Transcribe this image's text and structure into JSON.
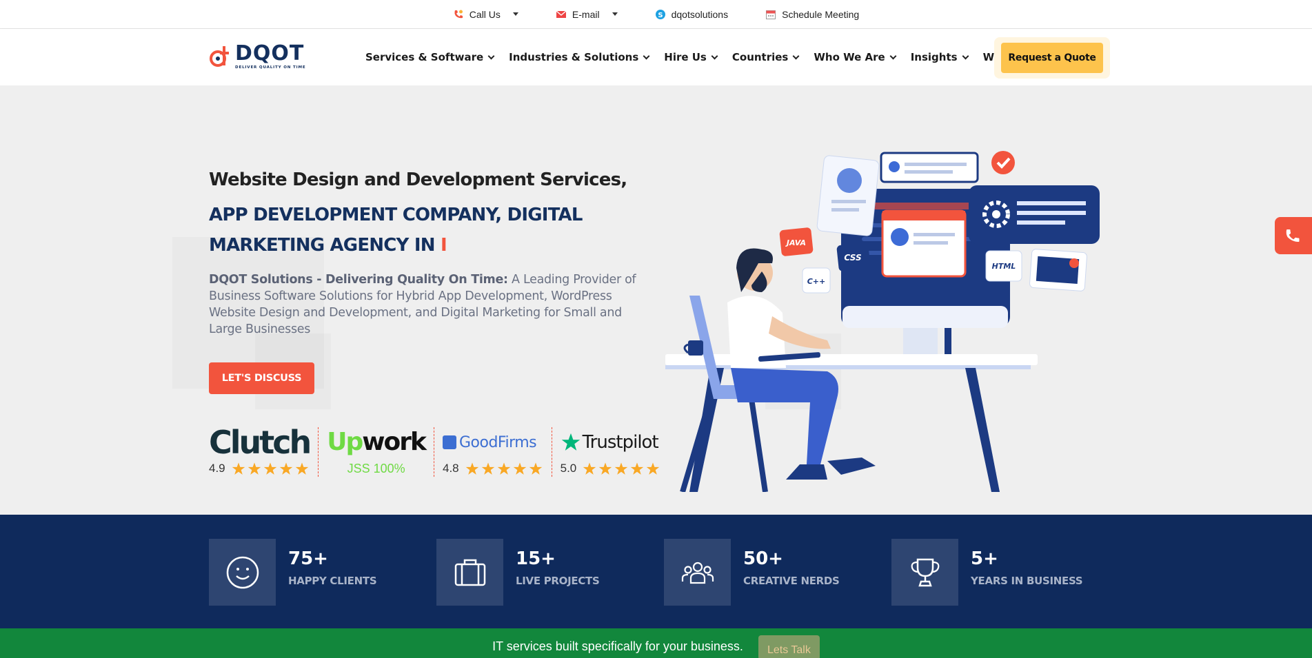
{
  "topbar": {
    "call_label": "Call Us",
    "email_label": "E-mail",
    "skype_label": "dqotsolutions",
    "schedule_label": "Schedule Meeting"
  },
  "brand": {
    "name": "DQOT",
    "tagline": "DELIVER QUALITY ON TIME"
  },
  "nav": {
    "items": [
      {
        "label": "Services & Software",
        "has_dropdown": true
      },
      {
        "label": "Industries & Solutions",
        "has_dropdown": true
      },
      {
        "label": "Hire Us",
        "has_dropdown": true
      },
      {
        "label": "Countries",
        "has_dropdown": true
      },
      {
        "label": "Who We Are",
        "has_dropdown": true
      },
      {
        "label": "Insights",
        "has_dropdown": true
      },
      {
        "label": "Work",
        "has_dropdown": false
      }
    ],
    "quote_label": "Request a Quote"
  },
  "hero": {
    "headline_line1": "Website Design and Development Services,",
    "headline_line2": "APP DEVELOPMENT COMPANY, DIGITAL MARKETING AGENCY IN",
    "typing_cursor": "I",
    "lead_bold": "DQOT Solutions - Delivering Quality On Time:",
    "lead_text": " A Leading Provider of Business Software Solutions for Hybrid App Development, WordPress Website Design and Development, and Digital Marketing for Small and Large Businesses",
    "cta_label": "LET'S DISCUSS"
  },
  "reviews": [
    {
      "platform": "Clutch",
      "rating": "4.9",
      "stars": 5
    },
    {
      "platform": "Upwork",
      "score_text": "JSS 100%"
    },
    {
      "platform": "GoodFirms",
      "rating": "4.8",
      "stars": 5
    },
    {
      "platform": "Trustpilot",
      "rating": "5.0",
      "stars": 5
    }
  ],
  "illustration": {
    "tags": [
      "JAVA",
      "CSS",
      "C++",
      "HTML"
    ]
  },
  "stats": [
    {
      "number": "75+",
      "label": "HAPPY CLIENTS",
      "icon": "smile-icon"
    },
    {
      "number": "15+",
      "label": "LIVE PROJECTS",
      "icon": "briefcase-icon"
    },
    {
      "number": "50+",
      "label": "CREATIVE NERDS",
      "icon": "team-icon"
    },
    {
      "number": "5+",
      "label": "YEARS IN BUSINESS",
      "icon": "trophy-icon"
    }
  ],
  "banner": {
    "text": "IT services built specifically for your business.",
    "button_label": "Lets Talk"
  },
  "colors": {
    "navy": "#14305e",
    "accent_red": "#f2543d",
    "quote_yellow": "#fdc34c",
    "stats_bg": "#0f2a5c",
    "banner_green": "#12873c",
    "upwork_green": "#6fda44",
    "goodfirms_blue": "#3c6ed2",
    "trustpilot_green": "#00b67a",
    "star_orange": "#f9a825"
  }
}
